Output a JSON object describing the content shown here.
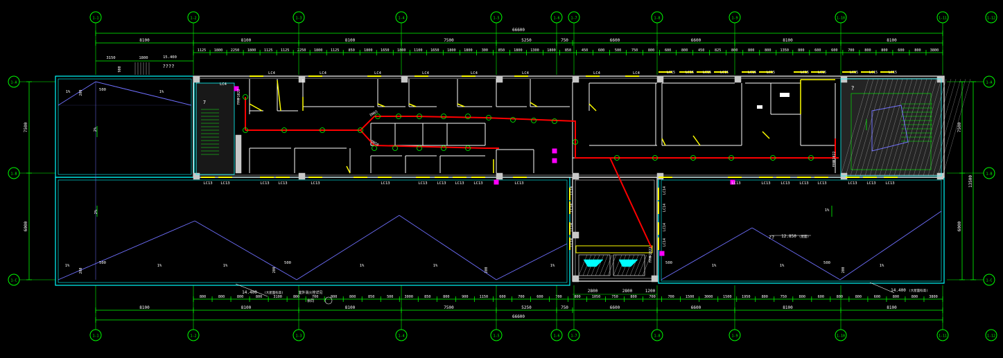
{
  "drawing": {
    "background": "#000000",
    "colors": {
      "axis": "#00ff00",
      "wall": "#ffffff",
      "window": "#ffff00",
      "fire_pipe": "#ff0000",
      "outline": "#00ffff",
      "roof": "#7070ff",
      "hatch": "#c8c8c8",
      "tag": "#ff00ff"
    },
    "axis_tags": [
      "1-1",
      "1-2",
      "1-3",
      "1-4",
      "1-5",
      "1-6",
      "1-7",
      "1-8",
      "1-9",
      "1-10",
      "1-11",
      "1-12",
      "1-13",
      "1-14"
    ],
    "side_axis_tags": [
      "1-A",
      "1-B",
      "1-C"
    ],
    "dims": {
      "overall": "66600",
      "top_bays": [
        "8100",
        "8100",
        "8100",
        "7500",
        "5250",
        "750",
        "6600",
        "6600",
        "8100",
        "8100"
      ],
      "top_details": [
        "1125",
        "1800",
        "2250",
        "1800",
        "1125",
        "1125",
        "2250",
        "1800",
        "1125",
        "850",
        "1800",
        "1650",
        "1800",
        "1100",
        "1650",
        "1800",
        "1800",
        "300",
        "850",
        "1800",
        "1300",
        "1800",
        "850",
        "450",
        "600",
        "500",
        "750",
        "800",
        "600",
        "800",
        "450",
        "825",
        "800",
        "800",
        "800",
        "1350",
        "800",
        "600",
        "600",
        "700",
        "800",
        "800",
        "600",
        "800",
        "3800"
      ],
      "top_extra": [
        "3150",
        "1800",
        "15.400",
        "????"
      ],
      "bottom_bays": [
        "8100",
        "8100",
        "8100",
        "7500",
        "5250",
        "750",
        "6600",
        "6600",
        "8100",
        "8100"
      ],
      "bottom_details": [
        "800",
        "800",
        "800",
        "800",
        "3100",
        "800",
        "700",
        "800",
        "800",
        "850",
        "500",
        "3000",
        "850",
        "800",
        "900",
        "1150",
        "600",
        "700",
        "600",
        "700",
        "800",
        "1050",
        "750",
        "800",
        "700",
        "700",
        "1500",
        "3000",
        "1500",
        "1950",
        "800",
        "750",
        "800",
        "600",
        "800",
        "800",
        "600",
        "800",
        "800",
        "3800"
      ],
      "bottom_mid": [
        "2800",
        "2800",
        "1200"
      ],
      "left": [
        "7500",
        "6000"
      ],
      "right": [
        "7500",
        "6000"
      ],
      "right_total": "13500"
    },
    "labels": {
      "lc4": "LC4",
      "lc13": "LC13",
      "lc14": "LC14",
      "lc15": "LC15",
      "slope": "1%",
      "slope2": "2%",
      "elev_left": "14.400",
      "elev_left_note": "(大屋面标高)",
      "elev_right": "14.400",
      "elev_right_note": "(大屋面标高)",
      "elev_mid": "12.850",
      "elev_mid_note": "(屋面)",
      "hydrant": "FM甲1022",
      "hydrant2": "FM甲1022",
      "dn_left": "DN65",
      "dn_mid": "DN50",
      "dim_500": "500",
      "dim_200": "200",
      "dim_900": "900",
      "question": "??",
      "q1": "?",
      "ref_note": "室外消火栓详见",
      "ref_note2": "余同",
      "mark_7": "7"
    }
  }
}
